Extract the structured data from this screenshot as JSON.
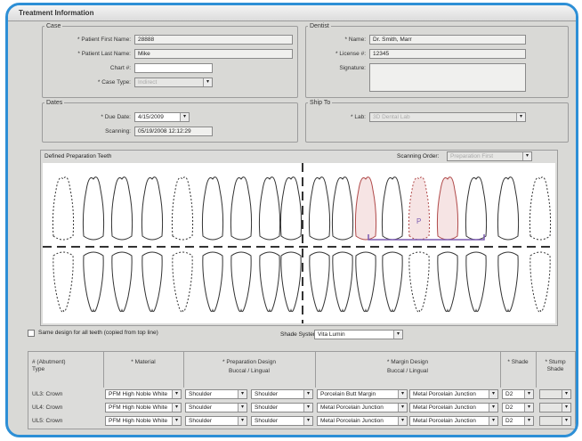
{
  "window": {
    "title": "Treatment Information"
  },
  "case": {
    "legend": "Case",
    "patient_first_name_label": "* Patient First Name:",
    "patient_first_name": "28888",
    "patient_last_name_label": "* Patient Last Name:",
    "patient_last_name": "Mike",
    "chart_label": "Chart #:",
    "chart_value": "",
    "case_type_label": "* Case Type:",
    "case_type_value": "Indirect"
  },
  "dentist": {
    "legend": "Dentist",
    "name_label": "* Name:",
    "name_value": "Dr. Smith, Marr",
    "license_label": "* License #:",
    "license_value": "12345",
    "signature_label": "Signature:"
  },
  "dates": {
    "legend": "Dates",
    "due_date_label": "* Due Date:",
    "due_date_value": "4/15/2009",
    "scanning_label": "Scanning:",
    "scanning_value": "05/19/2008 12:12:29"
  },
  "ship_to": {
    "legend": "Ship To",
    "lab_label": "* Lab:",
    "lab_value": "3D Dental Lab"
  },
  "teeth": {
    "legend": "Defined Preparation Teeth",
    "scanning_order_label": "Scanning Order:",
    "scanning_order_value": "Preparation First"
  },
  "options": {
    "same_design_label": "Same design for all teeth (copied from top line)",
    "shade_system_label": "Shade System:",
    "shade_system_value": "Vita Lumin"
  },
  "table": {
    "headers": {
      "type": "# (Abutment) Type",
      "material": "* Material",
      "prep_design": "* Preparation Design",
      "prep_sub": "Buccal / Lingual",
      "margin_design": "* Margin Design",
      "margin_sub": "Buccal / Lingual",
      "shade": "* Shade",
      "stump_shade": "* Stump Shade"
    },
    "rows": [
      {
        "type": "UL3: Crown",
        "material": "PFM High Noble White",
        "prep_buccal": "Shoulder",
        "prep_lingual": "Shoulder",
        "margin_buccal": "Porcelain Butt Margin",
        "margin_lingual": "Metal Porcelain Junction",
        "shade": "D2"
      },
      {
        "type": "UL4: Crown",
        "material": "PFM High Noble White",
        "prep_buccal": "Shoulder",
        "prep_lingual": "Shoulder",
        "margin_buccal": "Metal Porcelain Junction",
        "margin_lingual": "Metal Porcelain Junction",
        "shade": "D2"
      },
      {
        "type": "UL5: Crown",
        "material": "PFM High Noble White",
        "prep_buccal": "Shoulder",
        "prep_lingual": "Shoulder",
        "margin_buccal": "Metal Porcelain Junction",
        "margin_lingual": "Metal Porcelain Junction",
        "shade": "D2"
      }
    ]
  },
  "colors": {
    "frame_border": "#2d8fd6",
    "prep_tooth": "#b04a4a",
    "bridge": "#7a5ab0"
  }
}
